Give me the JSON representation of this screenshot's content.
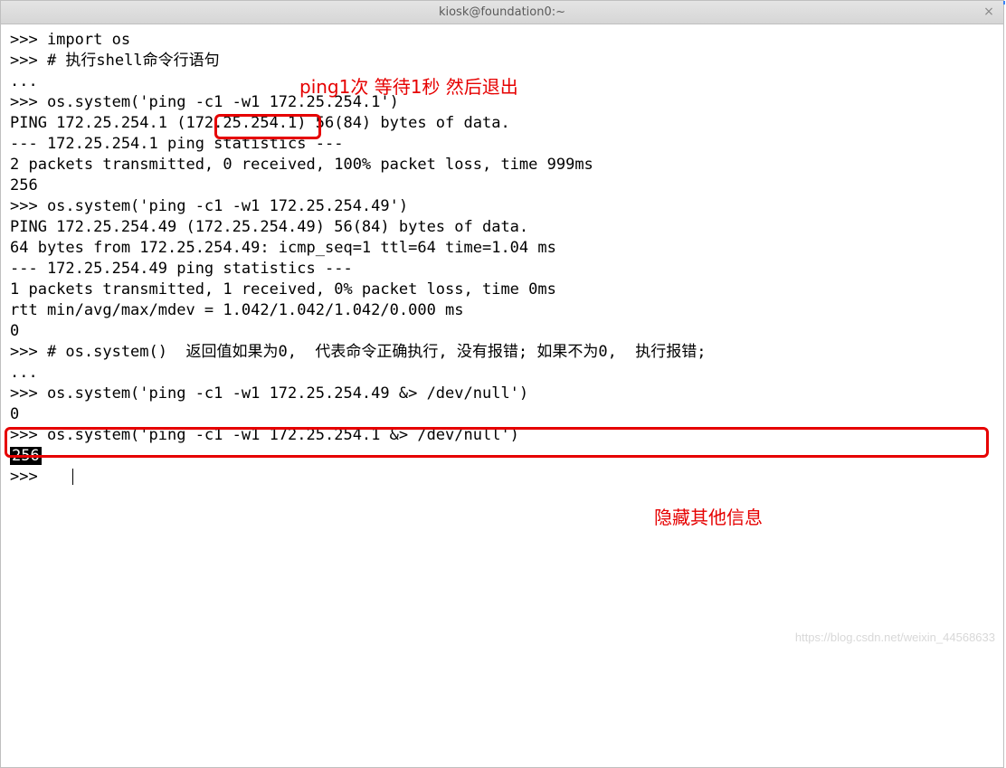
{
  "window": {
    "title": "kiosk@foundation0:~",
    "close_glyph": "×"
  },
  "annotations": {
    "box_args_label": "ping1次 等待1秒 然后退出",
    "comment_box_label": "",
    "hide_info_label": "隐藏其他信息"
  },
  "terminal": {
    "lines": [
      {
        "prefix": ">>> ",
        "text": "import os"
      },
      {
        "prefix": ">>> ",
        "text": "# 执行shell命令行语句"
      },
      {
        "prefix": "",
        "text": "..."
      },
      {
        "prefix": ">>> ",
        "text": "os.system('ping -c1 -w1 172.25.254.1')"
      },
      {
        "prefix": "",
        "text": "PING 172.25.254.1 (172.25.254.1) 56(84) bytes of data."
      },
      {
        "prefix": "",
        "text": ""
      },
      {
        "prefix": "",
        "text": "--- 172.25.254.1 ping statistics ---"
      },
      {
        "prefix": "",
        "text": "2 packets transmitted, 0 received, 100% packet loss, time 999ms"
      },
      {
        "prefix": "",
        "text": ""
      },
      {
        "prefix": "",
        "text": "256"
      },
      {
        "prefix": ">>> ",
        "text": "os.system('ping -c1 -w1 172.25.254.49')"
      },
      {
        "prefix": "",
        "text": "PING 172.25.254.49 (172.25.254.49) 56(84) bytes of data."
      },
      {
        "prefix": "",
        "text": "64 bytes from 172.25.254.49: icmp_seq=1 ttl=64 time=1.04 ms"
      },
      {
        "prefix": "",
        "text": ""
      },
      {
        "prefix": "",
        "text": "--- 172.25.254.49 ping statistics ---"
      },
      {
        "prefix": "",
        "text": "1 packets transmitted, 1 received, 0% packet loss, time 0ms"
      },
      {
        "prefix": "",
        "text": "rtt min/avg/max/mdev = 1.042/1.042/1.042/0.000 ms"
      },
      {
        "prefix": "",
        "text": "0"
      },
      {
        "prefix": ">>> ",
        "text": "# os.system()  返回值如果为0,  代表命令正确执行, 没有报错; 如果不为0,  执行报错;"
      },
      {
        "prefix": "",
        "text": "..."
      },
      {
        "prefix": ">>> ",
        "text": "os.system('ping -c1 -w1 172.25.254.49 &> /dev/null')"
      },
      {
        "prefix": "",
        "text": "0"
      },
      {
        "prefix": ">>> ",
        "text": "os.system('ping -c1 -w1 172.25.254.1 &> /dev/null')"
      },
      {
        "prefix": "",
        "text": "256",
        "highlight": true
      },
      {
        "prefix": ">>> ",
        "text": "",
        "cursor": true
      }
    ]
  },
  "watermark": "https://blog.csdn.net/weixin_44568633"
}
